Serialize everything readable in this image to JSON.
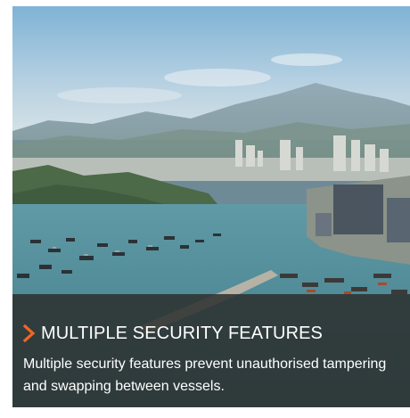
{
  "feature_card": {
    "image": {
      "alt": "Aerial view of a harbour with anchored vessels, city and mountains"
    },
    "title": "MULTIPLE SECURITY FEATURES",
    "description": "Multiple security features prevent unauthorised tampering and swapping between vessels.",
    "icon": "chevron-right-icon",
    "colors": {
      "accent": "#f26522",
      "overlay": "#2c302e",
      "text": "#ffffff"
    }
  }
}
